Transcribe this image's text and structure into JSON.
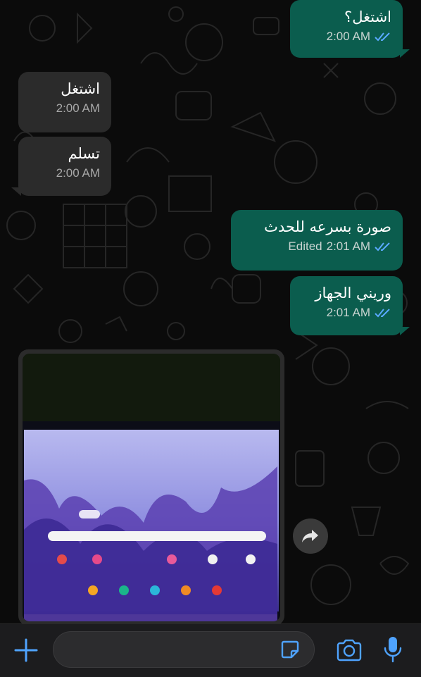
{
  "colors": {
    "outgoing_bubble": "#0b5d4e",
    "incoming_bubble": "#2b2b2b",
    "accent_blue": "#4fa3ff",
    "read_ticks": "#5aa9ff",
    "background": "#0b0b0b"
  },
  "messages": [
    {
      "direction": "outgoing",
      "text": "اشتغل؟",
      "time": "2:00 AM",
      "status": "read"
    },
    {
      "direction": "incoming",
      "text": "اشتغل",
      "time": "2:00 AM"
    },
    {
      "direction": "incoming",
      "text": "تسلم",
      "time": "2:00 AM"
    },
    {
      "direction": "outgoing",
      "text": "صورة بسرعه للحدث",
      "edited": "Edited",
      "time": "2:01 AM",
      "status": "read"
    },
    {
      "direction": "outgoing",
      "text": "وريني الجهاز",
      "time": "2:01 AM",
      "status": "read"
    }
  ],
  "photo_message": {
    "direction": "incoming",
    "content": "photo-of-tablet-home-screen"
  },
  "icons": {
    "forward": "forward-icon",
    "plus": "plus-icon",
    "sticker": "sticker-icon",
    "camera": "camera-icon",
    "mic": "microphone-icon"
  },
  "composer": {
    "placeholder": ""
  }
}
